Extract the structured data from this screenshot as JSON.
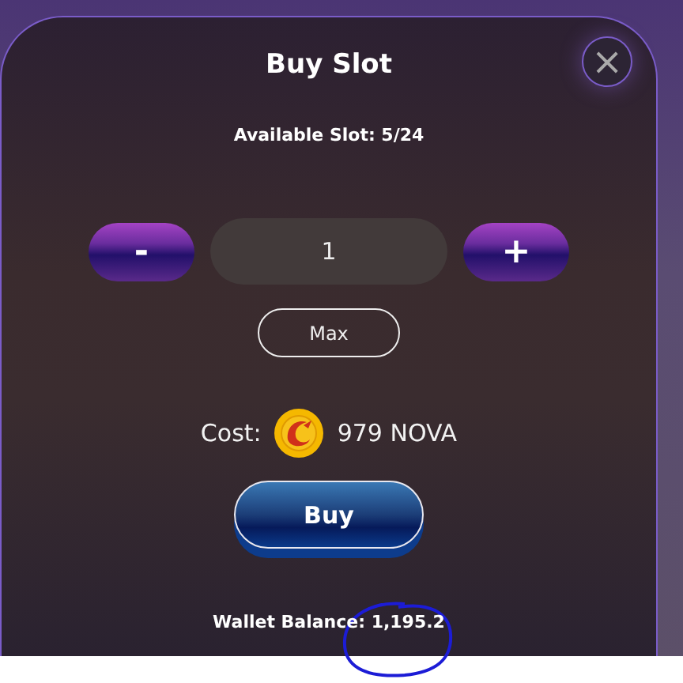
{
  "dialog": {
    "title": "Buy Slot",
    "close_label": "×",
    "available": "Available Slot: 5/24"
  },
  "quantity": {
    "minus_label": "-",
    "value": "1",
    "plus_label": "+",
    "max_label": "Max"
  },
  "cost": {
    "label": "Cost:",
    "amount": "979 NOVA"
  },
  "buy_label": "Buy",
  "wallet_balance": "Wallet Balance: 1,195.2"
}
